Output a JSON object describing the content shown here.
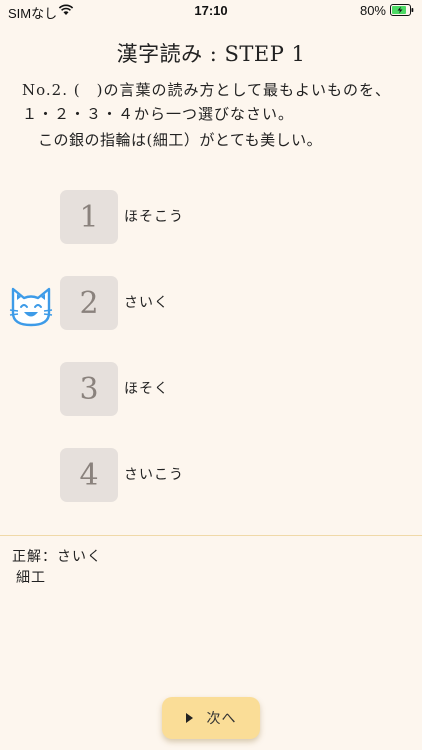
{
  "status_bar": {
    "carrier": "SIMなし",
    "time": "17:10",
    "battery_percent": "80%"
  },
  "screen": {
    "title": "漢字読み : STEP 1",
    "question_text": "No.2. (　)の言葉の読み方として最もよいものを、１・２・３・４から一つ選びなさい。",
    "sentence": "この銀の指輪は(細工）がとても美しい。"
  },
  "choices": [
    {
      "number": "1",
      "reading": "ほそこう"
    },
    {
      "number": "2",
      "reading": "さいく"
    },
    {
      "number": "3",
      "reading": "ほそく"
    },
    {
      "number": "4",
      "reading": "さいこう"
    }
  ],
  "answer": {
    "line": "正解：さいく",
    "kanji": "細工"
  },
  "next_button": {
    "label": "次へ"
  },
  "colors": {
    "background": "#fdf6ee",
    "choice_box": "#e6e0dc",
    "button": "#fadd97",
    "cat_icon": "#3d9be8"
  },
  "icons": {
    "selected_marker": "cat-face-icon",
    "next": "play-icon"
  }
}
